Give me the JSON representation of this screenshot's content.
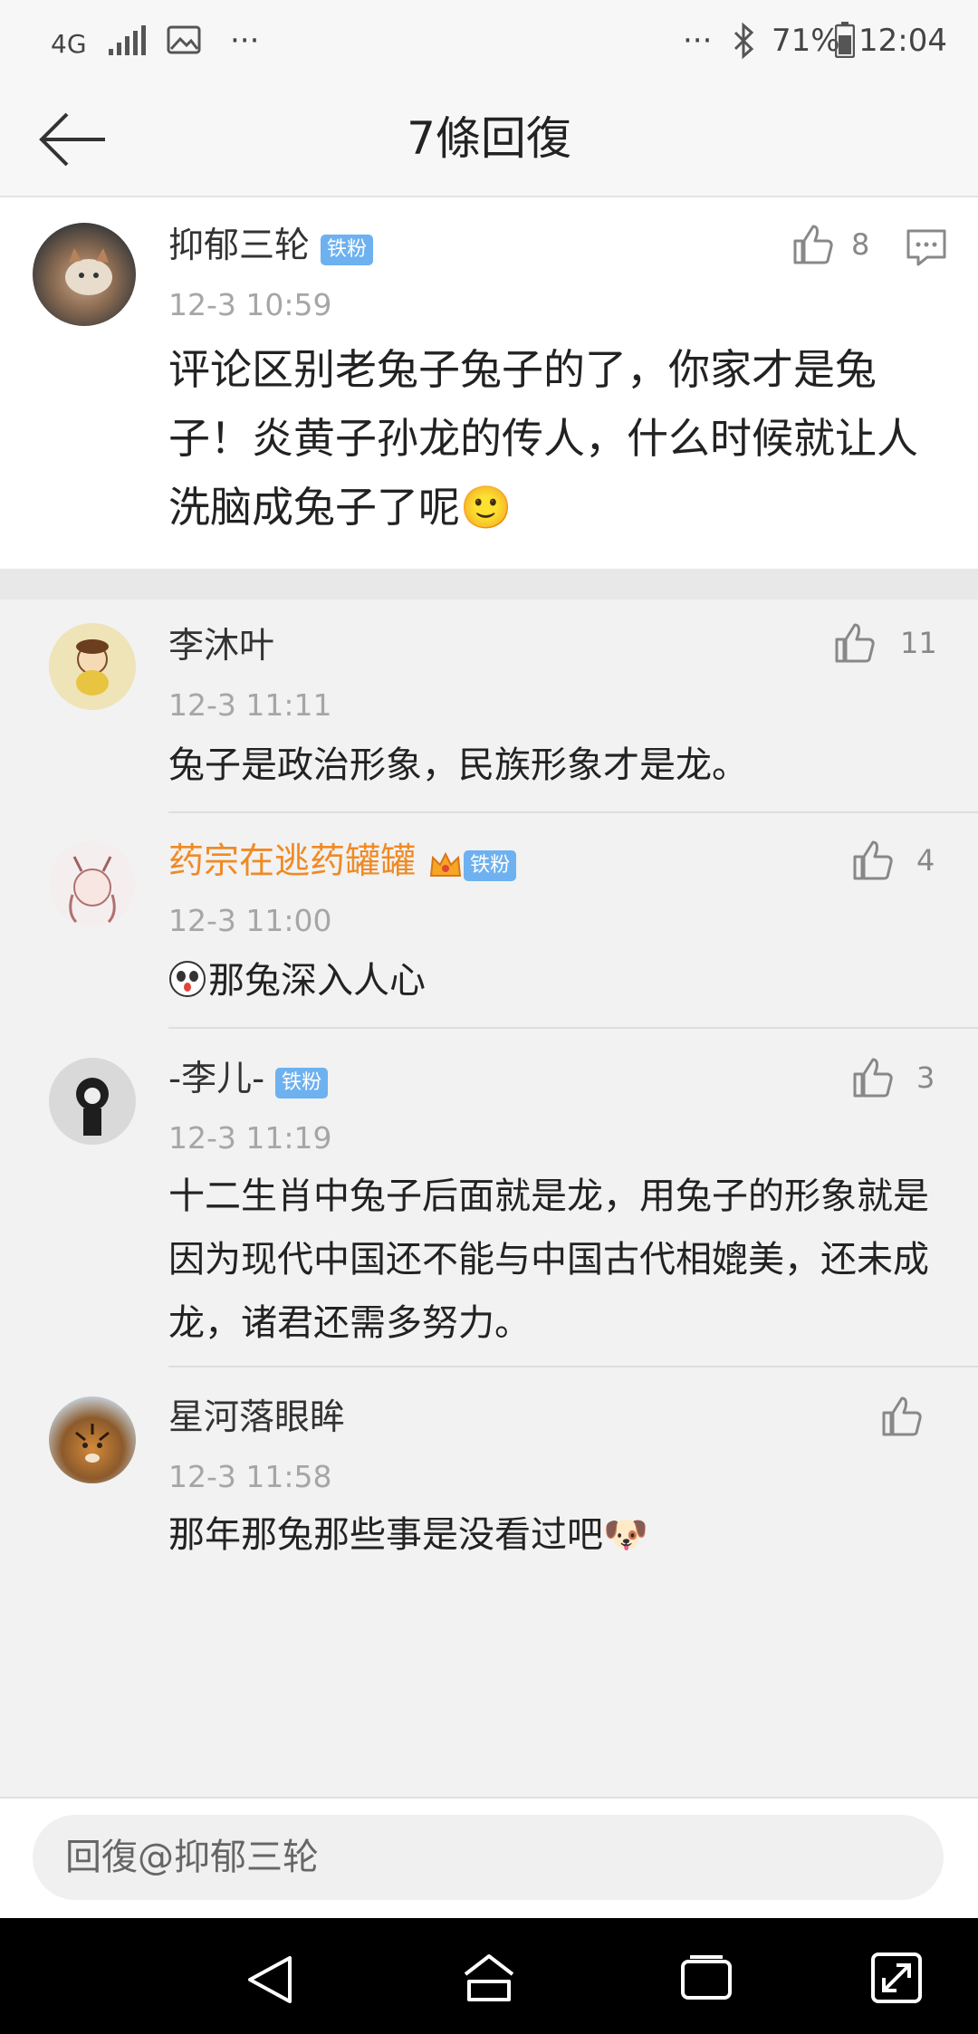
{
  "status_bar": {
    "network": "4G",
    "ellipsis_left": "···",
    "ellipsis_right": "···",
    "battery": "71%",
    "time": "12:04"
  },
  "header": {
    "title": "7條回復"
  },
  "main_comment": {
    "user": "抑郁三轮",
    "badge": "铁粉",
    "time": "12-3 10:59",
    "likes": "8",
    "text": "评论区别老兔子兔子的了，你家才是兔子！炎黄子孙龙的传人，什么时候就让人洗脑成兔子了呢",
    "emoji": "🙂"
  },
  "replies": [
    {
      "user": "李沐叶",
      "time": "12-3 11:11",
      "likes": "11",
      "text": "兔子是政治形象，民族形象才是龙。"
    },
    {
      "user": "药宗在逃药罐罐",
      "badge": "铁粉",
      "time": "12-3 11:00",
      "likes": "4",
      "text": "那兔深入人心",
      "name_color": "#f08a24"
    },
    {
      "user": "-李儿-",
      "badge": "铁粉",
      "time": "12-3 11:19",
      "likes": "3",
      "text": "十二生肖中兔子后面就是龙，用兔子的形象就是因为现代中国还不能与中国古代相媲美，还未成龙，诸君还需多努力。"
    },
    {
      "user": "星河落眼眸",
      "time": "12-3 11:58",
      "likes": "",
      "text": "那年那兔那些事是没看过吧",
      "emoji": "🐶"
    }
  ],
  "input": {
    "placeholder": "回復@抑郁三轮"
  }
}
